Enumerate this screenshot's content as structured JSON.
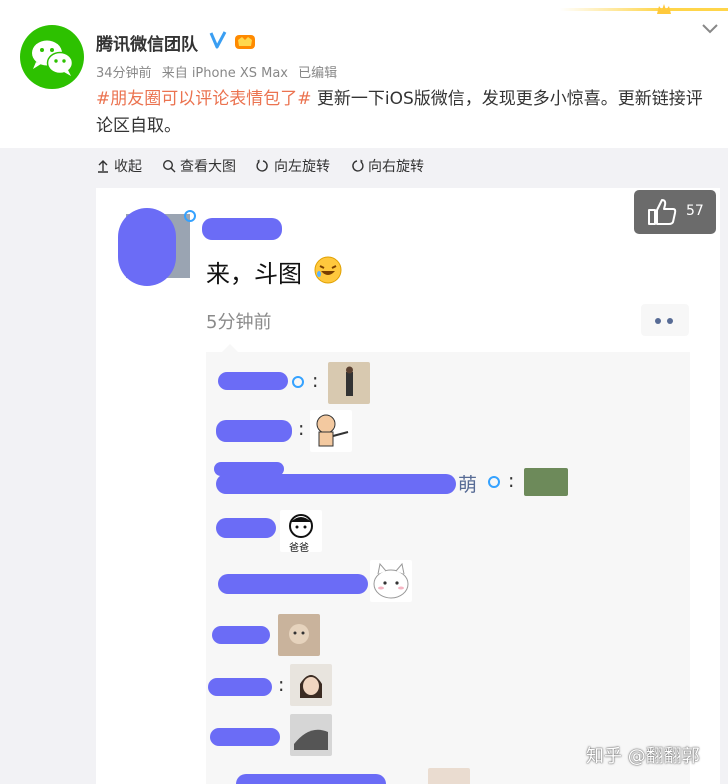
{
  "post": {
    "author": "腾讯微信团队",
    "time": "34分钟前",
    "source": "来自 iPhone XS Max",
    "edited": "已编辑",
    "hashtag": "#朋友圈可以评论表情包了#",
    "text": " 更新一下iOS版微信，发现更多小惊喜。更新链接评论区自取。"
  },
  "toolbar": {
    "collapse": "收起",
    "view_large": "查看大图",
    "rotate_left": "向左旋转",
    "rotate_right": "向右旋转"
  },
  "moment": {
    "text": "来，斗图",
    "time": "5分钟前",
    "comment_names": [
      "萌"
    ]
  },
  "stickers": {
    "dad": "爸爸"
  },
  "like": {
    "count": "57"
  },
  "watermark": "知乎 @翻翻郭",
  "colors": {
    "accent": "#eb7350",
    "link": "#576b95",
    "wechat_green": "#2dc100",
    "redaction": "#6b6cf6"
  },
  "icons": [
    "wechat-logo-icon",
    "verified-icon",
    "vip-icon",
    "chevron-down-icon",
    "collapse-icon",
    "search-icon",
    "rotate-left-icon",
    "rotate-right-icon",
    "like-icon",
    "laugh-emoji-icon"
  ]
}
